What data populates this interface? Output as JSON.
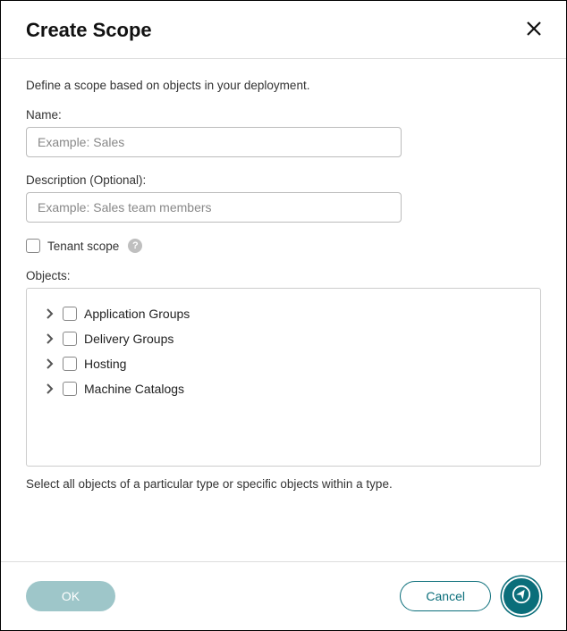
{
  "header": {
    "title": "Create Scope"
  },
  "intro": "Define a scope based on objects in your deployment.",
  "name": {
    "label": "Name:",
    "placeholder": "Example: Sales",
    "value": ""
  },
  "description": {
    "label": "Description (Optional):",
    "placeholder": "Example: Sales team members",
    "value": ""
  },
  "tenant_scope": {
    "label": "Tenant scope",
    "checked": false,
    "help": "?"
  },
  "objects": {
    "label": "Objects:",
    "items": [
      {
        "label": "Application Groups",
        "checked": false,
        "expanded": false
      },
      {
        "label": "Delivery Groups",
        "checked": false,
        "expanded": false
      },
      {
        "label": "Hosting",
        "checked": false,
        "expanded": false
      },
      {
        "label": "Machine Catalogs",
        "checked": false,
        "expanded": false
      }
    ],
    "hint": "Select all objects of a particular type or specific objects within a type."
  },
  "footer": {
    "ok": "OK",
    "cancel": "Cancel"
  }
}
